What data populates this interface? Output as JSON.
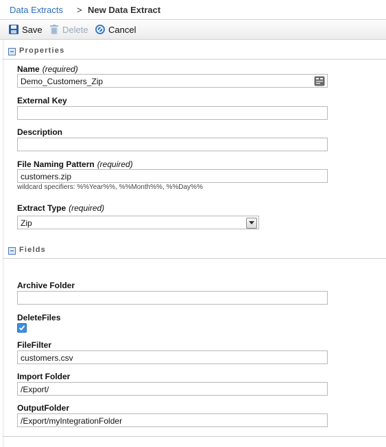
{
  "breadcrumb": {
    "parent": "Data Extracts",
    "separator": ">",
    "current": "New Data Extract"
  },
  "toolbar": {
    "save": "Save",
    "delete": "Delete",
    "cancel": "Cancel"
  },
  "sections": {
    "properties": "Properties",
    "fields": "Fields"
  },
  "properties": {
    "name_label": "Name",
    "name_required": "(required)",
    "name_value": "Demo_Customers_Zip",
    "external_key_label": "External Key",
    "external_key_value": "",
    "description_label": "Description",
    "description_value": "",
    "file_naming_label": "File Naming Pattern",
    "file_naming_required": "(required)",
    "file_naming_value": "customers.zip",
    "wildcard_hint": "wildcard specifiers: %%Year%%, %%Month%%, %%Day%%",
    "extract_type_label": "Extract Type",
    "extract_type_required": "(required)",
    "extract_type_value": "Zip"
  },
  "fields": {
    "archive_folder_label": "Archive Folder",
    "archive_folder_value": "",
    "delete_files_label": "DeleteFiles",
    "delete_files_checked": true,
    "file_filter_label": "FileFilter",
    "file_filter_value": "customers.csv",
    "import_folder_label": "Import Folder",
    "import_folder_value": "/Export/",
    "output_folder_label": "OutputFolder",
    "output_folder_value": "/Export/myIntegrationFolder"
  },
  "icons": {
    "save": "floppy-disk-icon",
    "delete": "trash-icon",
    "cancel": "cancel-circle-icon",
    "lookup": "lookup-icon",
    "collapse": "collapse-box-icon"
  },
  "colors": {
    "link": "#2a6ebb",
    "accent": "#3d8ee0"
  }
}
